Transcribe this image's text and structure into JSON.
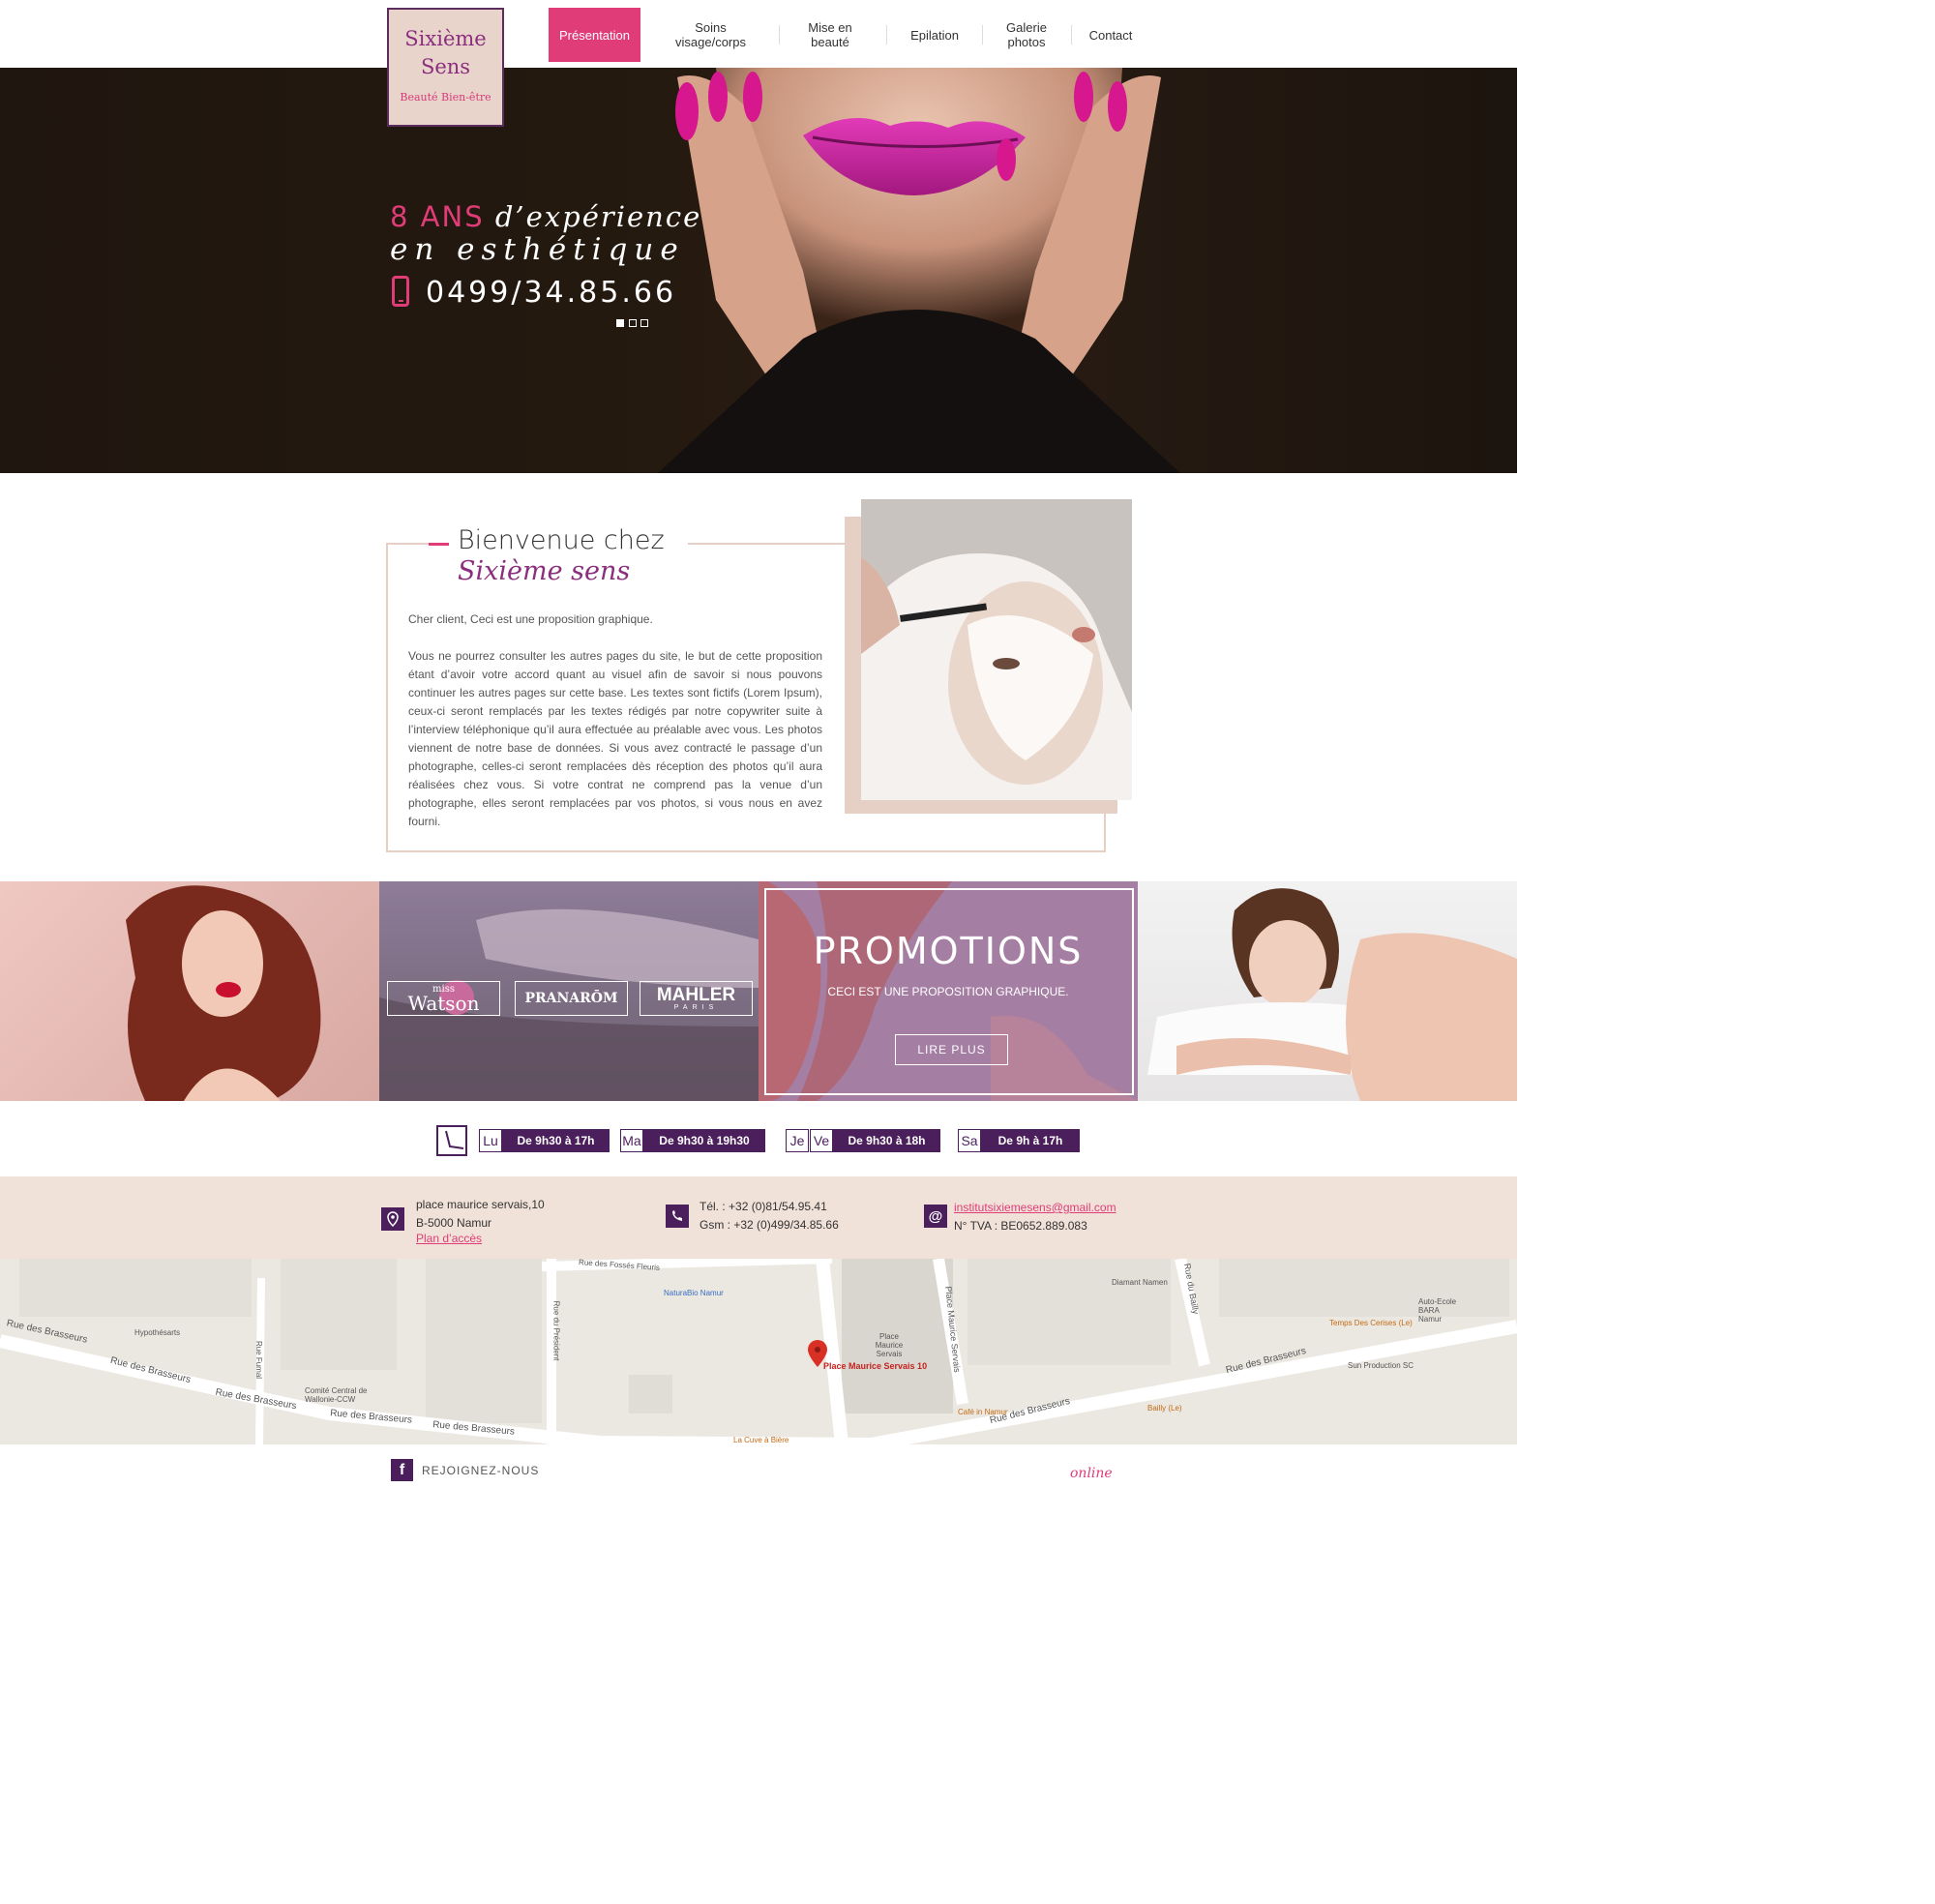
{
  "logo": {
    "line1": "Sixième",
    "line2": "Sens",
    "tagline": "Beauté  Bien-être"
  },
  "nav": {
    "items": [
      {
        "label": "Présentation",
        "active": true
      },
      {
        "label": "Soins visage/corps",
        "active": false
      },
      {
        "label": "Mise en beauté",
        "active": false
      },
      {
        "label": "Epilation",
        "active": false
      },
      {
        "label": "Galerie photos",
        "active": false
      },
      {
        "label": "Contact",
        "active": false
      }
    ]
  },
  "hero": {
    "accent": "8 ANS",
    "line1_rest": " d’expérience",
    "line2": "en esthétique",
    "phone": "0499/34.85.66",
    "slides": 3,
    "active_slide": 1
  },
  "welcome": {
    "title": "Bienvenue chez",
    "subtitle": "Sixième sens",
    "para1": "Cher client, Ceci est une proposition graphique.",
    "para2": "Vous ne pourrez consulter les autres pages du site, le but de cette proposition étant d’avoir votre accord quant au visuel afin de savoir si nous pouvons continuer les autres pages sur cette base. Les textes sont fictifs (Lorem Ipsum), ceux-ci seront remplacés par les textes rédigés par notre copywriter suite à l’interview téléphonique qu’il aura effectuée au préalable avec vous. Les photos viennent de notre base de données. Si vous avez contracté le passage d’un photographe, celles-ci seront remplacées dès réception des photos qu’il aura réalisées chez vous. Si votre contrat ne comprend pas la venue d’un photographe, elles seront remplacées par vos photos, si vous nous en avez fourni."
  },
  "brands": {
    "watson_small": "miss",
    "watson_big": "Watson",
    "pranarom": "PRANARŌM",
    "mahler": "MAHLER",
    "mahler_sub": "PARIS"
  },
  "promo": {
    "title": "PROMOTIONS",
    "subtitle": "CECI EST UNE PROPOSITION GRAPHIQUE.",
    "button": "LIRE PLUS"
  },
  "hours": [
    {
      "days": [
        "Lu"
      ],
      "time": "De 9h30 à 17h"
    },
    {
      "days": [
        "Ma"
      ],
      "time": "De 9h30 à 19h30"
    },
    {
      "days": [
        "Je",
        "Ve"
      ],
      "time": "De 9h30 à 18h"
    },
    {
      "days": [
        "Sa"
      ],
      "time": "De 9h à 17h"
    }
  ],
  "contact": {
    "address1": "place maurice servais,10",
    "address2": "B-5000 Namur",
    "map_link": "Plan d’accès",
    "tel": "Tél. : +32 (0)81/54.95.41",
    "gsm": "Gsm : +32 (0)499/34.85.66",
    "email": "institutsixiemesens@gmail.com",
    "tva": "N° TVA : BE0652.889.083"
  },
  "map": {
    "streets": [
      "Rue des Brasseurs",
      "Rue des Fossés Fleuris",
      "Rue du Président",
      "Rue Fumal",
      "Place Maurice Servais",
      "Rue du Bailly"
    ],
    "places": [
      "Hypothésarts",
      "NaturaBio Namur",
      "Comité Central de Wallonie-CCW",
      "Place Maurice Servais",
      "Diamant Namen",
      "Auto-Ecole BARA Namur",
      "Temps Des Cerises (Le)",
      "Sun Production SC",
      "Café in Namur",
      "Bailly (Le)",
      "La Cuve à Bière"
    ],
    "pin_label": "Place Maurice Servais 10"
  },
  "footer": {
    "social": "REJOIGNEZ-NOUS",
    "fb_letter": "f",
    "brand": "online"
  },
  "colors": {
    "accent": "#e03c77",
    "purple": "#4a1f5c",
    "beige": "#f1e2d9"
  }
}
